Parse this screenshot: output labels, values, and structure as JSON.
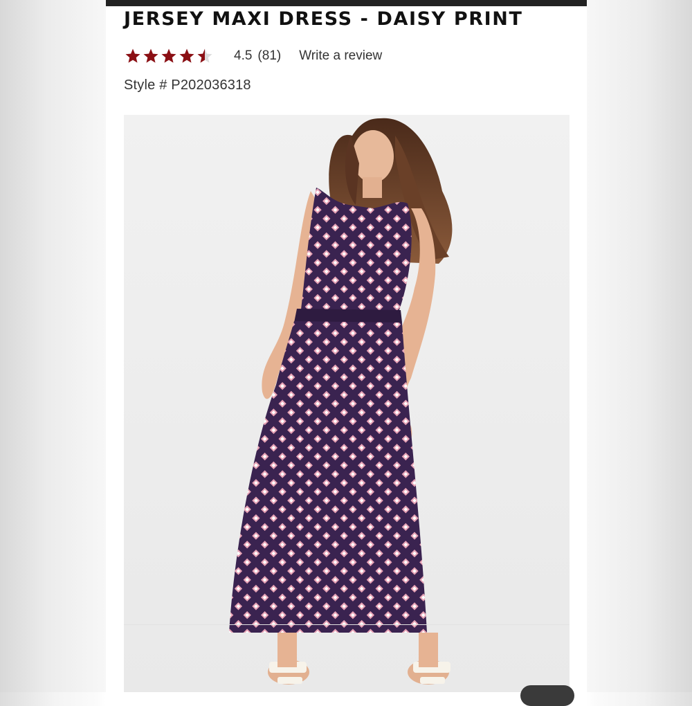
{
  "product": {
    "title": "JERSEY MAXI DRESS - DAISY PRINT",
    "rating_value": "4.5",
    "rating_count": "(81)",
    "rating_stars": 4.5,
    "star_color": "#8b0f14",
    "review_link": "Write a review",
    "style_number": "Style # P202036318"
  },
  "colors": {
    "dress": "#3a2350",
    "dress_print": "#e7a2b5",
    "header_bar": "#222222"
  },
  "icons": {
    "star": "star-icon",
    "chat": "chat-bubble-icon"
  }
}
